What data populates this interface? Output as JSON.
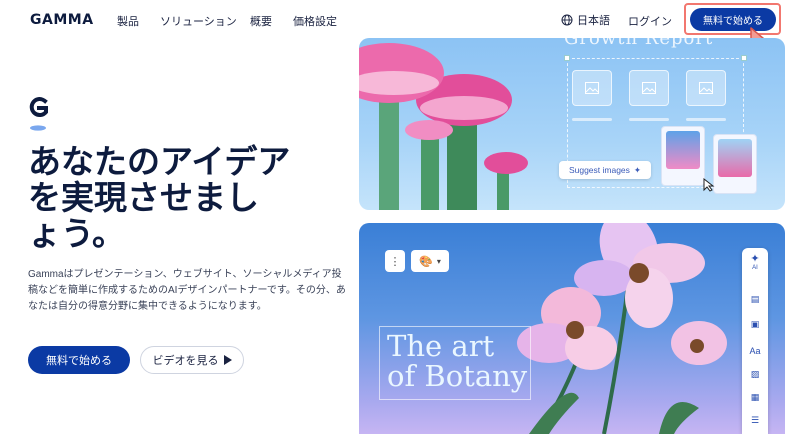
{
  "nav": {
    "logo": "GAMMA",
    "links": [
      "製品",
      "ソリューション",
      "概要",
      "価格設定"
    ],
    "language": "日本語",
    "login": "ログイン",
    "cta": "無料で始める"
  },
  "hero": {
    "headline_lines": [
      "あなたのアイデア",
      "を実現させまし",
      "ょう。"
    ],
    "description": "Gammaはプレゼンテーション、ウェブサイト、ソーシャルメディア投稿などを簡単に作成するためのAIデザインパートナーです。その分、あなたは自分の得意分野に集中できるようになります。",
    "primary_button": "無料で始める",
    "secondary_button": "ビデオを見る"
  },
  "card_top": {
    "title": "Growth Report",
    "suggest_label": "Suggest images"
  },
  "card_bottom": {
    "title_line1": "The art",
    "title_line2": "of Botany",
    "ai_label": "AI",
    "text_tool": "Aa"
  },
  "colors": {
    "brand": "#0b3aa4",
    "text_dark": "#0d1b3e",
    "highlight": "#f2776f"
  }
}
